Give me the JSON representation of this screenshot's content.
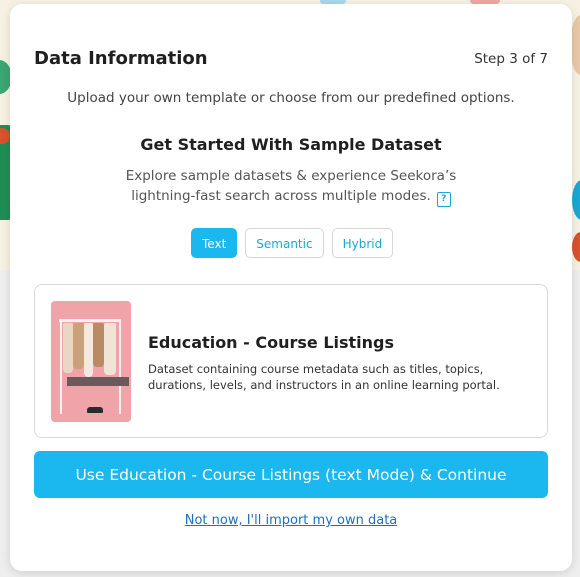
{
  "modal": {
    "title": "Data Information",
    "step": "Step 3 of 7",
    "subtitle": "Upload your own template or choose from our predefined options.",
    "section_title": "Get Started With Sample Dataset",
    "section_desc": "Explore sample datasets & experience Seekora’s lightning-fast search across multiple modes."
  },
  "modes": [
    {
      "label": "Text",
      "active": true
    },
    {
      "label": "Semantic",
      "active": false
    },
    {
      "label": "Hybrid",
      "active": false
    }
  ],
  "dataset_card": {
    "title": "Education - Course Listings",
    "description": "Dataset containing course metadata such as titles, topics, durations, levels, and instructors in an online learning portal."
  },
  "actions": {
    "continue_label": "Use Education - Course Listings (text Mode) & Continue",
    "skip_label": "Not now, I'll import my own data"
  },
  "icons": {
    "help": "help-icon"
  },
  "colors": {
    "accent": "#1bb7ef",
    "link": "#1f6fbf"
  }
}
